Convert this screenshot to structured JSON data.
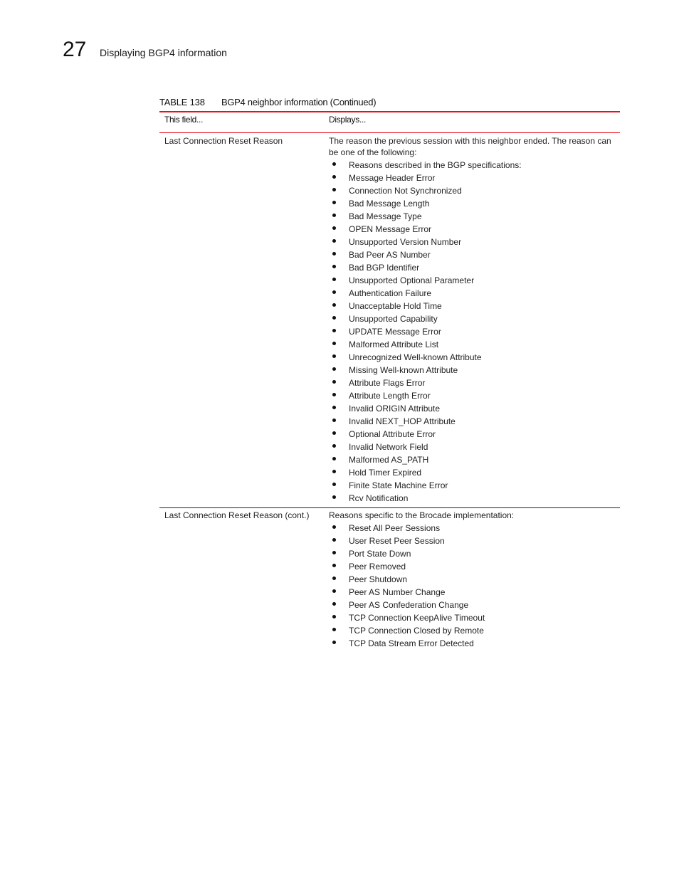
{
  "header": {
    "chapter_number": "27",
    "chapter_title": "Displaying BGP4 information"
  },
  "table": {
    "caption_label": "TABLE 138",
    "caption_title": "BGP4 neighbor information  (Continued)",
    "columns": [
      "This field...",
      "Displays..."
    ],
    "rows": [
      {
        "field": "Last Connection Reset Reason",
        "intro": "The reason the previous session with this neighbor ended.  The reason can be one of the following:",
        "bullets": [
          "Reasons described in the BGP specifications:",
          "Message Header Error",
          "Connection Not Synchronized",
          "Bad Message Length",
          "Bad Message Type",
          "OPEN Message Error",
          "Unsupported Version Number",
          "Bad Peer AS Number",
          "Bad BGP Identifier",
          "Unsupported Optional Parameter",
          "Authentication Failure",
          "Unacceptable Hold Time",
          "Unsupported Capability",
          "UPDATE Message Error",
          "Malformed Attribute List",
          "Unrecognized Well-known Attribute",
          "Missing Well-known Attribute",
          "Attribute Flags Error",
          "Attribute Length Error",
          "Invalid ORIGIN Attribute",
          "Invalid NEXT_HOP Attribute",
          "Optional Attribute Error",
          "Invalid Network Field",
          "Malformed AS_PATH",
          "Hold Timer Expired",
          "Finite State Machine Error",
          "Rcv Notification"
        ]
      },
      {
        "field": "Last Connection Reset Reason (cont.)",
        "intro": "Reasons specific to the Brocade implementation:",
        "bullets": [
          "Reset All Peer Sessions",
          "User Reset Peer Session",
          "Port State Down",
          "Peer Removed",
          "Peer Shutdown",
          "Peer AS Number Change",
          "Peer AS Confederation Change",
          "TCP Connection KeepAlive Timeout",
          "TCP Connection Closed by Remote",
          "TCP Data Stream Error Detected"
        ]
      }
    ]
  },
  "colors": {
    "accent_red": "#e8101e"
  }
}
